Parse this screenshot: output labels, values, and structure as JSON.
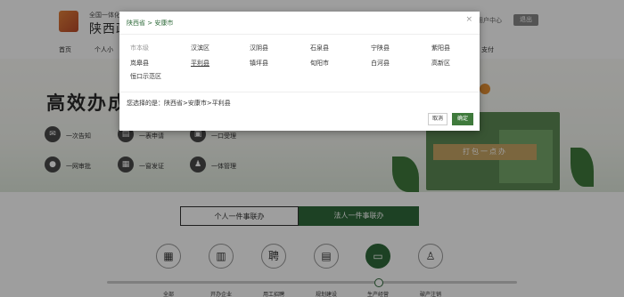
{
  "header": {
    "brand_sub": "全国一体化",
    "brand_main": "陕西政",
    "user_center": "用户中心",
    "exit_label": "退出"
  },
  "nav": {
    "items": [
      "首页",
      "个人小",
      "办"
    ]
  },
  "hero": {
    "title": "高效办成",
    "features": [
      "一次告知",
      "一表申请",
      "一口受理",
      "一网审批",
      "一窗发证",
      "一体管理"
    ],
    "ribbon": "打包一点办"
  },
  "bottom": {
    "tabs": [
      "个人一件事联办",
      "法人一件事联办"
    ],
    "active_tab": 1,
    "categories": [
      {
        "label": "全部",
        "icon": "grid-icon"
      },
      {
        "label": "开办企业",
        "icon": "building-icon"
      },
      {
        "label": "用工招聘",
        "icon": "hire-icon"
      },
      {
        "label": "规划建设",
        "icon": "construction-icon"
      },
      {
        "label": "生产经营",
        "icon": "briefcase-icon"
      },
      {
        "label": "破产注销",
        "icon": "person-icon"
      }
    ],
    "active_category": 4
  },
  "modal": {
    "breadcrumb": "陕西省 > 安康市",
    "close_glyph": "×",
    "options": [
      [
        "市本级",
        "汉滨区",
        "汉阴县",
        "石泉县",
        "宁陕县",
        "紫阳县"
      ],
      [
        "岚皋县",
        "平利县",
        "镇坪县",
        "旬阳市",
        "白河县",
        "高新区"
      ],
      [
        "恒口示范区"
      ]
    ],
    "selected_option": "平利县",
    "muted_option": "市本级",
    "result_label": "您选择的是：",
    "result_value": "陕西省>安康市>平利县",
    "cancel_label": "取消",
    "ok_label": "确定",
    "partial_text": "支付"
  },
  "colors": {
    "primary_green": "#2f6a3a",
    "button_green": "#3f7a3c"
  }
}
